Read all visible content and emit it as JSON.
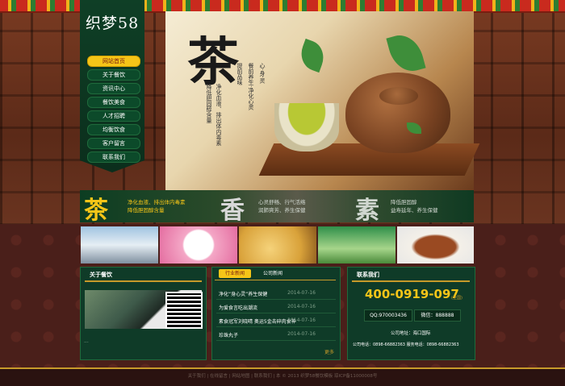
{
  "brand": {
    "logo_text": "织梦58"
  },
  "nav": {
    "items": [
      {
        "label": "网站首页",
        "active": true
      },
      {
        "label": "关于餐饮",
        "active": false
      },
      {
        "label": "资讯中心",
        "active": false
      },
      {
        "label": "餐饮美食",
        "active": false
      },
      {
        "label": "人才招聘",
        "active": false
      },
      {
        "label": "均衡饮食",
        "active": false
      },
      {
        "label": "客户留言",
        "active": false
      },
      {
        "label": "联系我们",
        "active": false
      }
    ]
  },
  "hero": {
    "big_char": "茶",
    "line_a": "提前品味",
    "line_b": "餐前养生·净化心灵",
    "line_c": "心·身·灵",
    "line_d": "净化血液、排出体内毒素",
    "line_e": "降低胆固醇含量"
  },
  "features": [
    {
      "char": "茶",
      "text1": "净化血液、排出体内毒素",
      "text2": "降低胆固醇含量"
    },
    {
      "char": "香",
      "text1": "心灵舒畅、行气活络",
      "text2": "润肺爽芳、养生保健"
    },
    {
      "char": "素",
      "text1": "降低胆固醇",
      "text2": "益寿延年、养生保健"
    }
  ],
  "thumbnails": [
    "thumb-yachts",
    "thumb-thanks",
    "thumb-banquet",
    "thumb-promo",
    "thumb-dish"
  ],
  "about": {
    "title": "关于餐饮",
    "more": "..."
  },
  "news": {
    "tabs": [
      {
        "label": "行业新闻"
      },
      {
        "label": "公司新闻"
      }
    ],
    "items": [
      {
        "title": "净化“身心灵”养生保健",
        "date": "2014-07-16"
      },
      {
        "title": "为爱食言吃出潮流",
        "date": "2014-07-16"
      },
      {
        "title": "素食冠军刘晓晴 奥运5金击碎肉食神",
        "date": "2014-07-16"
      },
      {
        "title": "珍珠丸子",
        "date": "2014-07-16"
      }
    ],
    "more": "更多"
  },
  "contact": {
    "title": "联系我们",
    "phone": "400-0919-097",
    "phone_note": "(全国)",
    "qq": "QQ:970003436",
    "wechat": "微信：888888",
    "address": "公司地址：海口国际",
    "tel": "公司电话：0898-66882363 服务电话：0898-66882363"
  },
  "footer": {
    "text": "关于我们 | 在线留言 | 网站地图 | 联系我们 | 本 © 2013 织梦58餐饮模板 琼ICP备11000008号"
  }
}
